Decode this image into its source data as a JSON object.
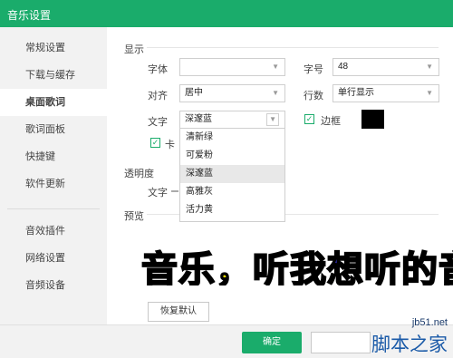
{
  "window": {
    "title": "音乐设置"
  },
  "sidebar": {
    "items": [
      {
        "label": "常规设置"
      },
      {
        "label": "下载与缓存"
      },
      {
        "label": "桌面歌词"
      },
      {
        "label": "歌词面板"
      },
      {
        "label": "快捷键"
      },
      {
        "label": "软件更新"
      },
      {
        "label": "音效插件"
      },
      {
        "label": "网络设置"
      },
      {
        "label": "音频设备"
      }
    ],
    "active_index": 2
  },
  "display": {
    "section_title": "显示",
    "font_label": "字体",
    "font_value": "",
    "size_label": "字号",
    "size_value": "48",
    "align_label": "对齐",
    "align_value": "居中",
    "lines_label": "行数",
    "lines_value": "单行显示",
    "text_label": "文字",
    "text_value": "深邃蓝",
    "border_label": "边框",
    "border_checked": true,
    "border_color": "#000000",
    "karaoke_label": "卡",
    "karaoke_checked": true
  },
  "color_dropdown": {
    "options": [
      "清新绿",
      "可爱粉",
      "深邃蓝",
      "高雅灰",
      "活力黄"
    ],
    "highlighted_index": 2
  },
  "transparency": {
    "section_title": "透明度",
    "text_label": "文字"
  },
  "preview": {
    "section_title": "预览",
    "lyric_part1": "音乐，听",
    "lyric_part2": "我想听的",
    "lyric_part3": "音",
    "reset_button": "恢复默认"
  },
  "footer": {
    "ok_button": "确定"
  },
  "watermark": {
    "site": "jb51.net",
    "name": "脚本之家"
  },
  "colors": {
    "accent": "#1aac6b",
    "lyric_unsung": "#fde500",
    "lyric_sung": "#2a2aa8"
  }
}
